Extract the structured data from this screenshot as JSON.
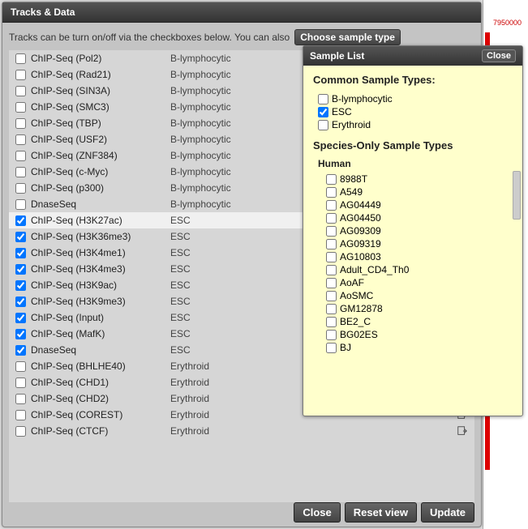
{
  "header": {
    "title": "Tracks & Data"
  },
  "instructions": {
    "text": "Tracks can be turn on/off via the checkboxes below. You can also",
    "choose_sample_label": "Choose sample type"
  },
  "tracks": [
    {
      "name": "ChIP-Seq (Pol2)",
      "type": "B-lymphocytic",
      "checked": false
    },
    {
      "name": "ChIP-Seq (Rad21)",
      "type": "B-lymphocytic",
      "checked": false
    },
    {
      "name": "ChIP-Seq (SIN3A)",
      "type": "B-lymphocytic",
      "checked": false
    },
    {
      "name": "ChIP-Seq (SMC3)",
      "type": "B-lymphocytic",
      "checked": false
    },
    {
      "name": "ChIP-Seq (TBP)",
      "type": "B-lymphocytic",
      "checked": false
    },
    {
      "name": "ChIP-Seq (USF2)",
      "type": "B-lymphocytic",
      "checked": false
    },
    {
      "name": "ChIP-Seq (ZNF384)",
      "type": "B-lymphocytic",
      "checked": false
    },
    {
      "name": "ChIP-Seq (c-Myc)",
      "type": "B-lymphocytic",
      "checked": false
    },
    {
      "name": "ChIP-Seq (p300)",
      "type": "B-lymphocytic",
      "checked": false
    },
    {
      "name": "DnaseSeq",
      "type": "B-lymphocytic",
      "checked": false
    },
    {
      "name": "ChIP-Seq (H3K27ac)",
      "type": "ESC",
      "checked": true,
      "highlight": true
    },
    {
      "name": "ChIP-Seq (H3K36me3)",
      "type": "ESC",
      "checked": true
    },
    {
      "name": "ChIP-Seq (H3K4me1)",
      "type": "ESC",
      "checked": true
    },
    {
      "name": "ChIP-Seq (H3K4me3)",
      "type": "ESC",
      "checked": true
    },
    {
      "name": "ChIP-Seq (H3K9ac)",
      "type": "ESC",
      "checked": true
    },
    {
      "name": "ChIP-Seq (H3K9me3)",
      "type": "ESC",
      "checked": true
    },
    {
      "name": "ChIP-Seq (Input)",
      "type": "ESC",
      "checked": true
    },
    {
      "name": "ChIP-Seq (MafK)",
      "type": "ESC",
      "checked": true
    },
    {
      "name": "DnaseSeq",
      "type": "ESC",
      "checked": true
    },
    {
      "name": "ChIP-Seq (BHLHE40)",
      "type": "Erythroid",
      "checked": false,
      "icon": true
    },
    {
      "name": "ChIP-Seq (CHD1)",
      "type": "Erythroid",
      "checked": false,
      "icon": true
    },
    {
      "name": "ChIP-Seq (CHD2)",
      "type": "Erythroid",
      "checked": false,
      "icon": true
    },
    {
      "name": "ChIP-Seq (COREST)",
      "type": "Erythroid",
      "checked": false,
      "icon": true
    },
    {
      "name": "ChIP-Seq (CTCF)",
      "type": "Erythroid",
      "checked": false,
      "icon": true
    }
  ],
  "footer": {
    "close": "Close",
    "reset": "Reset view",
    "update": "Update"
  },
  "sample_panel": {
    "title": "Sample List",
    "close": "Close",
    "common_title": "Common Sample Types:",
    "common": [
      {
        "name": "B-lymphocytic",
        "checked": false
      },
      {
        "name": "ESC",
        "checked": true
      },
      {
        "name": "Erythroid",
        "checked": false
      }
    ],
    "species_title": "Species-Only Sample Types",
    "species_group": "Human",
    "species": [
      {
        "name": "8988T",
        "checked": false
      },
      {
        "name": "A549",
        "checked": false
      },
      {
        "name": "AG04449",
        "checked": false
      },
      {
        "name": "AG04450",
        "checked": false
      },
      {
        "name": "AG09309",
        "checked": false
      },
      {
        "name": "AG09319",
        "checked": false
      },
      {
        "name": "AG10803",
        "checked": false
      },
      {
        "name": "Adult_CD4_Th0",
        "checked": false
      },
      {
        "name": "AoAF",
        "checked": false
      },
      {
        "name": "AoSMC",
        "checked": false
      },
      {
        "name": "GM12878",
        "checked": false
      },
      {
        "name": "BE2_C",
        "checked": false
      },
      {
        "name": "BG02ES",
        "checked": false
      },
      {
        "name": "BJ",
        "checked": false
      }
    ]
  },
  "bg_label": "7950000"
}
